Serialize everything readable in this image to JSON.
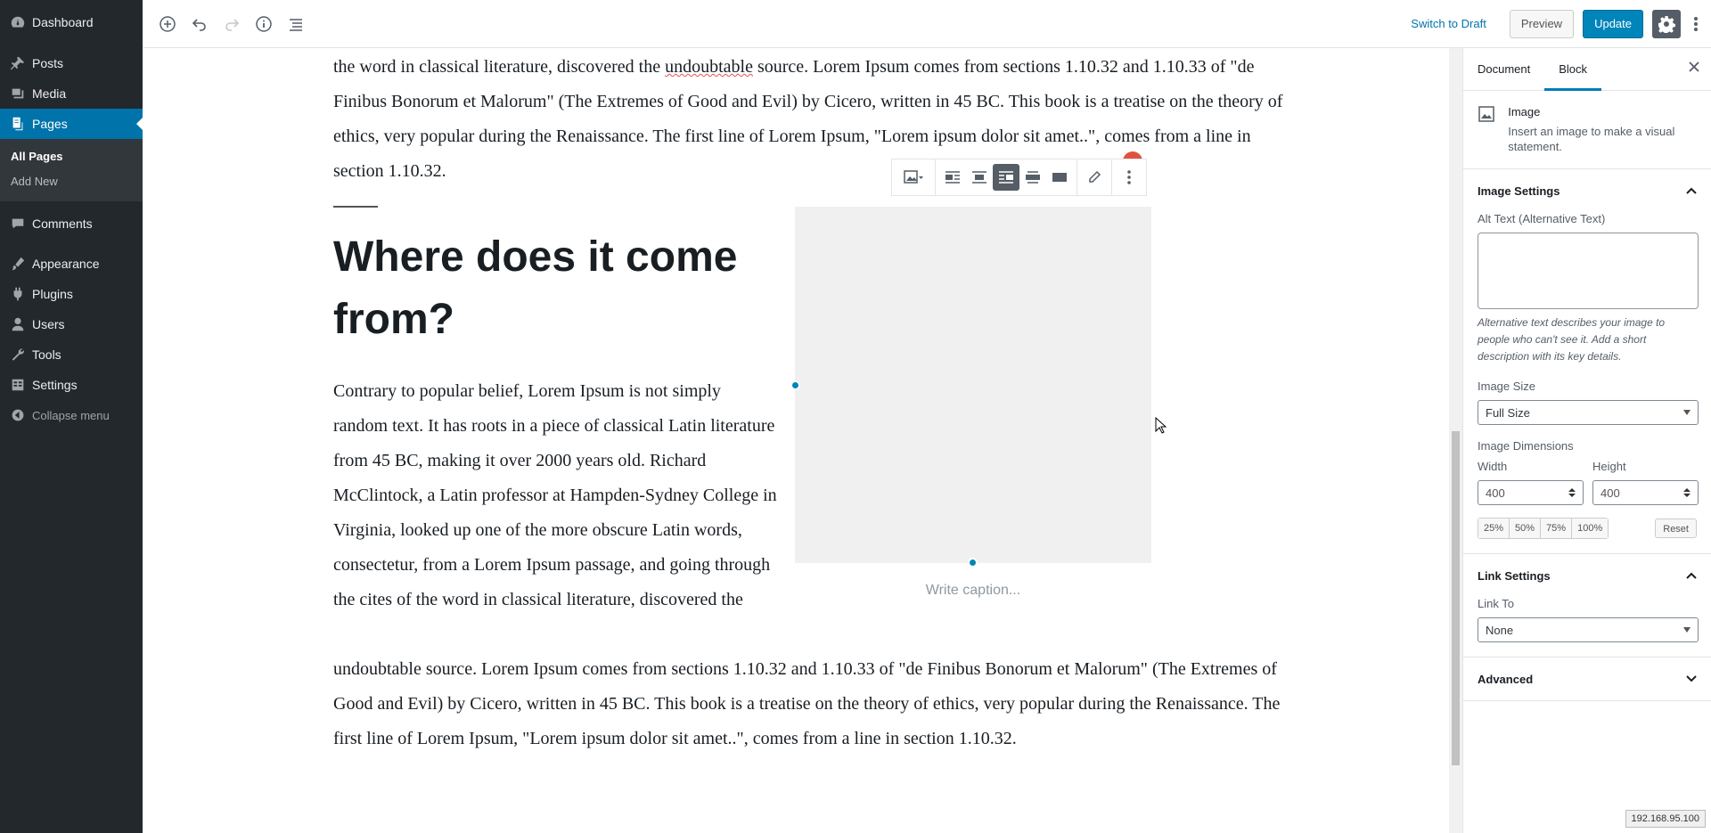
{
  "admin_menu": {
    "items": [
      {
        "label": "Dashboard",
        "icon": "dashboard-icon"
      },
      {
        "label": "Posts",
        "icon": "pin-icon"
      },
      {
        "label": "Media",
        "icon": "media-icon"
      },
      {
        "label": "Pages",
        "icon": "pages-icon"
      },
      {
        "label": "Comments",
        "icon": "comment-icon"
      },
      {
        "label": "Appearance",
        "icon": "brush-icon"
      },
      {
        "label": "Plugins",
        "icon": "plugin-icon"
      },
      {
        "label": "Users",
        "icon": "user-icon"
      },
      {
        "label": "Tools",
        "icon": "wrench-icon"
      },
      {
        "label": "Settings",
        "icon": "settings-icon"
      }
    ],
    "submenu": [
      "All Pages",
      "Add New"
    ],
    "collapse": "Collapse menu"
  },
  "topbar": {
    "switch_to_draft": "Switch to Draft",
    "preview": "Preview",
    "update": "Update"
  },
  "editor": {
    "top_paragraph_parts": {
      "a": "the word in classical literature, discovered the ",
      "spell": "undoubtable",
      "b": " source. Lorem Ipsum comes from sections 1.10.32 and 1.10.33 of \"de Finibus Bonorum et Malorum\" (The Extremes of Good and Evil) by Cicero, written in 45 BC. This book is a treatise on the theory of ethics, very popular during the Renaissance. The first line of Lorem Ipsum, \"Lorem ipsum dolor sit amet..\", comes from a line in section 1.10.32."
    },
    "heading": "Where does it come from?",
    "float_paragraph": "Contrary to popular belief, Lorem Ipsum is not simply random text. It has roots in a piece of classical Latin literature from 45 BC, making it over 2000 years old. Richard McClintock, a Latin professor at Hampden-Sydney College in Virginia, looked up one of the more obscure Latin words, consectetur, from a Lorem Ipsum passage, and going through the cites of the word in classical literature, discovered the",
    "bottom_paragraph": "undoubtable source. Lorem Ipsum comes from sections 1.10.32 and 1.10.33 of \"de Finibus Bonorum et Malorum\" (The Extremes of Good and Evil) by Cicero, written in 45 BC. This book is a treatise on the theory of ethics, very popular during the Renaissance. The first line of Lorem Ipsum, \"Lorem ipsum dolor sit amet..\", comes from a line in section 1.10.32.",
    "caption_placeholder": "Write caption..."
  },
  "sidebar": {
    "tabs": [
      "Document",
      "Block"
    ],
    "active_tab": "Block",
    "block_card": {
      "title": "Image",
      "description": "Insert an image to make a visual statement."
    },
    "image_settings": {
      "title": "Image Settings",
      "alt_label": "Alt Text (Alternative Text)",
      "alt_help": "Alternative text describes your image to people who can't see it. Add a short description with its key details.",
      "size_label": "Image Size",
      "size_value": "Full Size",
      "dimensions_label": "Image Dimensions",
      "width_label": "Width",
      "width_value": "400",
      "height_label": "Height",
      "height_value": "400",
      "percents": [
        "25%",
        "50%",
        "75%",
        "100%"
      ],
      "reset": "Reset"
    },
    "link_settings": {
      "title": "Link Settings",
      "link_to_label": "Link To",
      "link_to_value": "None"
    },
    "advanced": {
      "title": "Advanced"
    }
  },
  "status": {
    "ip": "192.168.95.100"
  },
  "colors": {
    "accent": "#0073aa",
    "sidebar_bg": "#23282d",
    "update_btn": "#0085ba"
  }
}
